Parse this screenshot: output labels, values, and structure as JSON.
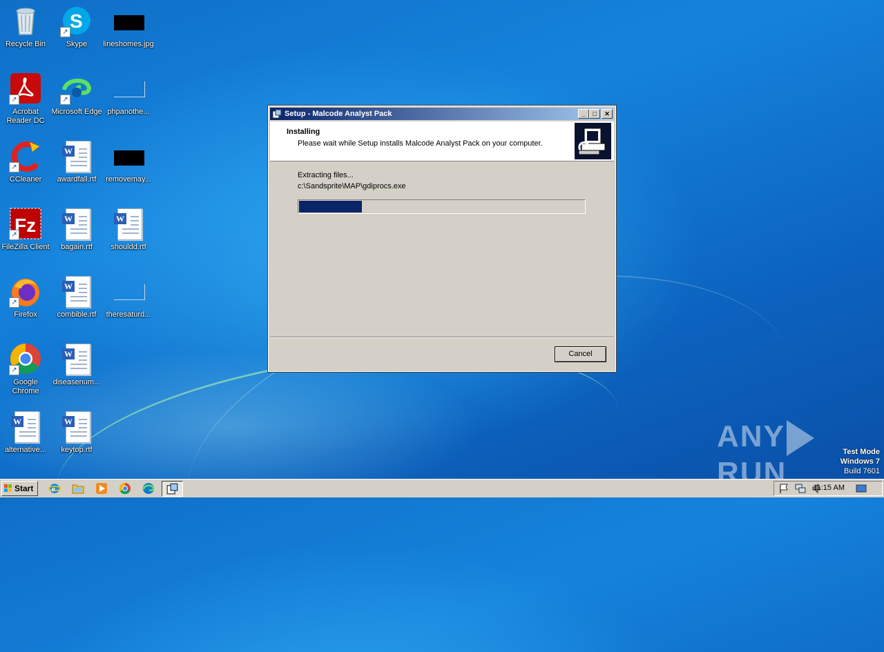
{
  "desktop": {
    "icons": [
      {
        "label": "Recycle Bin",
        "icon": "recycle-bin-icon"
      },
      {
        "label": "Skype",
        "icon": "skype-icon"
      },
      {
        "label": "lineshomes.jpg",
        "icon": "image-file-icon"
      },
      {
        "label": "Acrobat Reader DC",
        "icon": "acrobat-icon"
      },
      {
        "label": "Microsoft Edge",
        "icon": "edge-icon"
      },
      {
        "label": "phpanothe...",
        "icon": "image-file-icon"
      },
      {
        "label": "CCleaner",
        "icon": "ccleaner-icon"
      },
      {
        "label": "awardfall.rtf",
        "icon": "word-document-icon"
      },
      {
        "label": "removemay...",
        "icon": "image-file-icon"
      },
      {
        "label": "FileZilla Client",
        "icon": "filezilla-icon"
      },
      {
        "label": "bagain.rtf",
        "icon": "word-document-icon"
      },
      {
        "label": "shouldd.rtf",
        "icon": "word-document-icon"
      },
      {
        "label": "Firefox",
        "icon": "firefox-icon"
      },
      {
        "label": "combible.rtf",
        "icon": "word-document-icon"
      },
      {
        "label": "theresaturd...",
        "icon": "image-file-icon"
      },
      {
        "label": "Google Chrome",
        "icon": "chrome-icon"
      },
      {
        "label": "diseasenum...",
        "icon": "word-document-icon"
      },
      {
        "label": "alternative...",
        "icon": "word-document-icon"
      },
      {
        "label": "keytop.rtf",
        "icon": "word-document-icon"
      }
    ]
  },
  "dialog": {
    "title": "Setup - Malcode Analyst Pack",
    "header_title": "Installing",
    "header_subtitle": "Please wait while Setup installs Malcode Analyst Pack on your computer.",
    "status_text": "Extracting files...",
    "current_file": "c:\\Sandsprite\\MAP\\gdiprocs.exe",
    "progress_fraction": 0.22,
    "cancel_label": "Cancel",
    "minimize_glyph": "_",
    "maximize_glyph": "□",
    "close_glyph": "✕"
  },
  "watermark": {
    "brand_left": "ANY",
    "brand_right": "RUN",
    "mode": "Test Mode",
    "os": "Windows 7",
    "build": "Build 7601"
  },
  "taskbar": {
    "start_label": "Start",
    "clock": "11:15 AM",
    "pinned": [
      "internet-explorer-icon",
      "folder-icon",
      "media-player-icon",
      "chrome-icon",
      "edge-icon",
      "setup-icon"
    ],
    "tray": [
      "flag-icon",
      "network-icon",
      "volume-icon",
      "show-desktop-icon"
    ]
  },
  "colors": {
    "title_active_start": "#0a246a",
    "title_active_end": "#a6caf0",
    "progress_fill": "#0a246a",
    "dialog_face": "#d4d0c8"
  }
}
